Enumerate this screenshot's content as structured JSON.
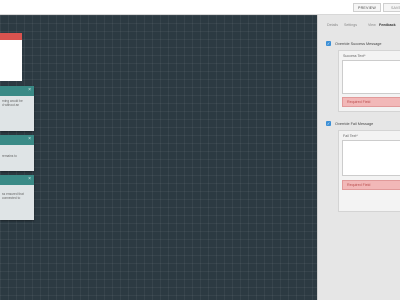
{
  "toolbar": {
    "preview_label": "PREVIEW",
    "save_label": "SAVE D"
  },
  "panel": {
    "tabs": [
      "Details",
      "Settings",
      "View",
      "Feedback"
    ],
    "success": {
      "checkbox_label": "Override Success Message",
      "field_label": "Success Text*",
      "error": "Required Field"
    },
    "fail": {
      "checkbox_label": "Override Fail Message",
      "field_label": "Fail Text*",
      "error": "Required Field"
    }
  },
  "cards": [
    {
      "lines": [
        "rning would be",
        "d without an"
      ]
    },
    {
      "lines": [
        "remains to"
      ]
    },
    {
      "lines": [
        "ss ensured that",
        "connected to"
      ]
    }
  ],
  "colors": {
    "accent": "#3b8fd6",
    "teal": "#3a8a86",
    "red": "#d9534f",
    "canvas": "#2c3a42"
  }
}
